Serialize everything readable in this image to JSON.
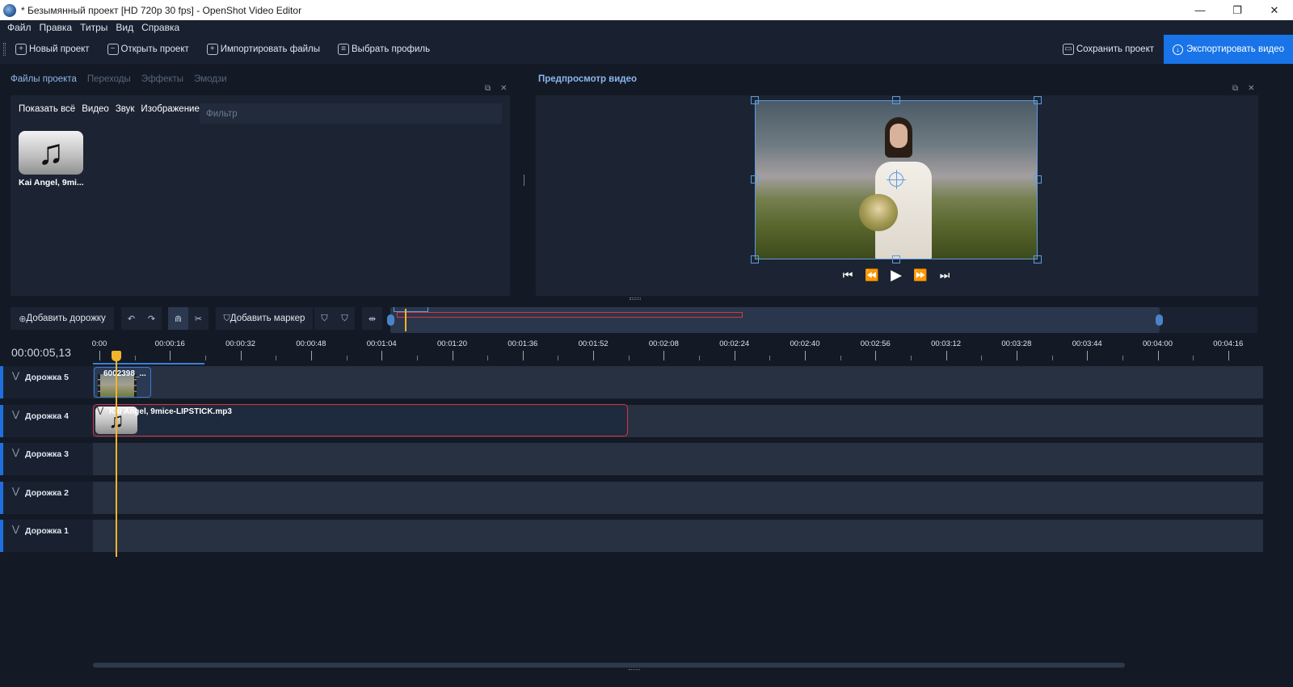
{
  "window": {
    "title": "* Безымянный проект [HD 720p 30 fps] - OpenShot Video Editor",
    "minimize": "—",
    "restore": "❐",
    "close": "✕"
  },
  "menu": [
    "Файл",
    "Правка",
    "Титры",
    "Вид",
    "Справка"
  ],
  "toolbar": {
    "new_project": "Новый проект",
    "open_project": "Открыть проект",
    "import_files": "Импортировать файлы",
    "choose_profile": "Выбрать профиль",
    "save_project": "Сохранить проект",
    "export_video": "Экспортировать видео",
    "accent_color": "#1874e8"
  },
  "project_panel": {
    "tabs": [
      "Файлы проекта",
      "Переходы",
      "Эффекты",
      "Эмодзи"
    ],
    "active_tab": "Файлы проекта",
    "filters": [
      "Показать всё",
      "Видео",
      "Звук",
      "Изображение"
    ],
    "filter_placeholder": "Фильтр",
    "files": [
      {
        "name": "Kai Angel, 9mi...",
        "icon": "music-note-icon",
        "glyph": "♫"
      }
    ]
  },
  "preview": {
    "title": "Предпросмотр видео",
    "controls": {
      "jump_start": "⏮",
      "rewind": "⏪",
      "play": "▶",
      "fast_forward": "⏩",
      "jump_end": "⏭"
    }
  },
  "timeline": {
    "add_track": "Добавить дорожку",
    "add_marker": "Добавить маркер",
    "undo": "↶",
    "redo": "↷",
    "snap": "⋒",
    "razor": "✂",
    "marker_prev": "⛉",
    "marker_next": "⛉",
    "center": "⇹",
    "timecode": "00:00:05,13",
    "ruler_labels": [
      "0:00",
      "00:00:16",
      "00:00:32",
      "00:00:48",
      "00:01:04",
      "00:01:20",
      "00:01:36",
      "00:01:52",
      "00:02:08",
      "00:02:24",
      "00:02:40",
      "00:02:56",
      "00:03:12",
      "00:03:28",
      "00:03:44",
      "00:04:00",
      "00:04:16"
    ],
    "tracks": [
      {
        "name": "Дорожка 5"
      },
      {
        "name": "Дорожка 4"
      },
      {
        "name": "Дорожка 3"
      },
      {
        "name": "Дорожка 2"
      },
      {
        "name": "Дорожка 1"
      }
    ],
    "clips": {
      "video": "6002398_...",
      "audio": "Kai Angel, 9mice-LIPSTICK.mp3",
      "audio_glyph": "♫"
    },
    "playhead_color": "#f0b52a",
    "selected_clip_color": "#d9363e"
  }
}
